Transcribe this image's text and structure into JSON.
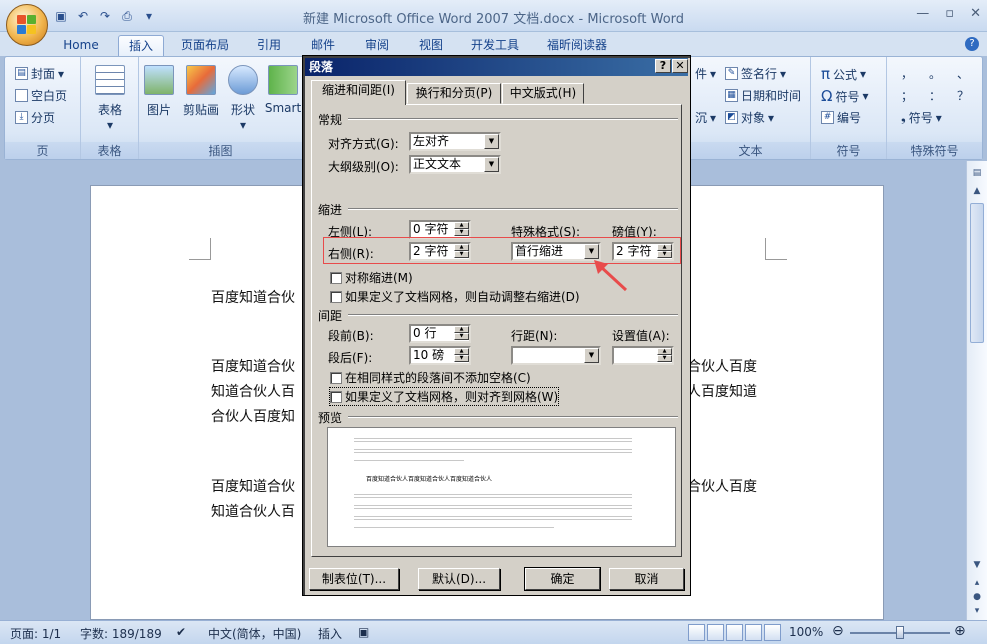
{
  "window": {
    "title": "新建 Microsoft Office Word 2007 文档.docx - Microsoft Word",
    "minimize": "—",
    "restore": "▫",
    "close": "✕"
  },
  "qat": {
    "icons": [
      "save-icon",
      "undo-icon",
      "redo-icon",
      "print-preview-icon",
      "qat-dropdown-icon"
    ]
  },
  "tabs": [
    "Home",
    "插入",
    "页面布局",
    "引用",
    "邮件",
    "审阅",
    "视图",
    "开发工具",
    "福昕阅读器"
  ],
  "active_tab": "插入",
  "ribbon": {
    "pages": {
      "cover": "封面",
      "blank": "空白页",
      "break": "分页",
      "label": "页"
    },
    "table": {
      "button": "表格",
      "label": "表格"
    },
    "illus": {
      "picture": "图片",
      "clipart": "剪贴画",
      "shapes": "形状",
      "smartart": "Smart",
      "label": "插图"
    },
    "text": {
      "parts": "件",
      "sign": "签名行",
      "datetime": "日期和时间",
      "shen": "沉",
      "object": "对象",
      "label": "文本"
    },
    "symbols": {
      "formula": "公式",
      "symbol": "符号",
      "number": "编号",
      "label": "符号"
    },
    "special": {
      "row1": [
        "，",
        "。",
        "、"
      ],
      "row2": [
        "；",
        "：",
        "？"
      ],
      "btn": "符号",
      "label": "特殊符号"
    }
  },
  "document": {
    "lines": [
      "百度知道合伙",
      "百度知道合伙",
      "知道合伙人百",
      "合伙人百度知",
      "百度知道合伙",
      "知道合伙人百"
    ],
    "right_lines": [
      "合伙人百度",
      "人百度知道",
      "合伙人百度"
    ]
  },
  "dialog": {
    "title": "段落",
    "help": "?",
    "close": "✕",
    "tabs": [
      "缩进和间距(I)",
      "换行和分页(P)",
      "中文版式(H)"
    ],
    "general": {
      "heading": "常规",
      "align_label": "对齐方式(G):",
      "align_value": "左对齐",
      "outline_label": "大纲级别(O):",
      "outline_value": "正文文本"
    },
    "indent": {
      "heading": "缩进",
      "left_label": "左侧(L):",
      "left_value": "0 字符",
      "right_label": "右侧(R):",
      "right_value": "2 字符",
      "special_label": "特殊格式(S):",
      "special_value": "首行缩进",
      "by_label": "磅值(Y):",
      "by_value": "2 字符",
      "mirror": "对称缩进(M)",
      "auto_adjust": "如果定义了文档网格，则自动调整右缩进(D)"
    },
    "spacing": {
      "heading": "间距",
      "before_label": "段前(B):",
      "before_value": "0 行",
      "after_label": "段后(F):",
      "after_value": "10 磅",
      "line_label": "行距(N):",
      "line_value": "",
      "at_label": "设置值(A):",
      "at_value": "",
      "no_space": "在相同样式的段落间不添加空格(C)",
      "snap_grid": "如果定义了文档网格，则对齐到网格(W)"
    },
    "preview": {
      "heading": "预览",
      "sample": "百度知道合伙人百度知道合伙人百度知道合伙人"
    },
    "buttons": {
      "tabs": "制表位(T)...",
      "default": "默认(D)...",
      "ok": "确定",
      "cancel": "取消"
    }
  },
  "status": {
    "page": "页面: 1/1",
    "words": "字数: 189/189",
    "lang": "中文(简体，中国)",
    "mode": "插入",
    "zoom": "100%"
  },
  "colors": {
    "highlight": "#e84b4b",
    "title_bar": "#0a246a"
  }
}
